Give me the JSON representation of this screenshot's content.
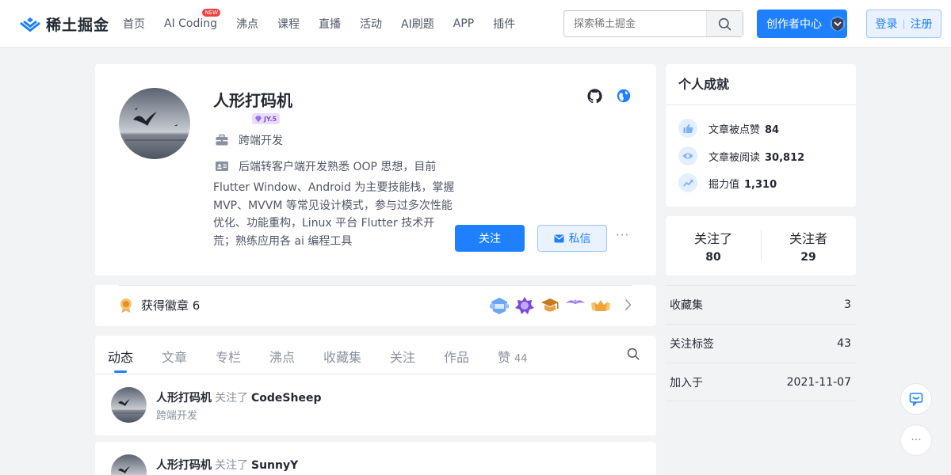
{
  "header": {
    "logo_text": "稀土掘金",
    "nav": [
      {
        "label": "首页"
      },
      {
        "label": "AI Coding",
        "badge": "NEW"
      },
      {
        "label": "沸点"
      },
      {
        "label": "课程"
      },
      {
        "label": "直播"
      },
      {
        "label": "活动"
      },
      {
        "label": "AI刷题"
      },
      {
        "label": "APP"
      },
      {
        "label": "插件"
      }
    ],
    "search_placeholder": "探索稀土掘金",
    "creator_label": "创作者中心",
    "login_label": "登录",
    "login_sep": "|",
    "register_label": "注册"
  },
  "profile": {
    "name": "人形打码机",
    "level": "JY.5",
    "job": "跨端开发",
    "bio_first": "后端转客户端开发熟悉 OOP 思想，目前",
    "bio_rest": "Flutter Window、Android 为主要技能栈，掌握 MVP、MVVM 等常见设计模式，参与过多次性能优化、功能重构，Linux 平台 Flutter 技术开荒；熟练应用各 ai 编程工具",
    "follow_label": "关注",
    "message_label": "私信",
    "more_label": "···"
  },
  "badges": {
    "title": "获得徽章 6"
  },
  "tabs": [
    {
      "label": "动态"
    },
    {
      "label": "文章"
    },
    {
      "label": "专栏"
    },
    {
      "label": "沸点"
    },
    {
      "label": "收藏集"
    },
    {
      "label": "关注"
    },
    {
      "label": "作品"
    },
    {
      "label": "赞",
      "count": "44"
    }
  ],
  "activities": [
    {
      "name": "人形打码机",
      "verb": "关注了",
      "target": "CodeSheep",
      "sub": "跨端开发"
    },
    {
      "name": "人形打码机",
      "verb": "关注了",
      "target": "SunnyY",
      "sub": ""
    }
  ],
  "achievements": {
    "title": "个人成就",
    "rows": [
      {
        "label": "文章被点赞",
        "value": "84"
      },
      {
        "label": "文章被阅读",
        "value": "30,812"
      },
      {
        "label": "掘力值",
        "value": "1,310"
      }
    ]
  },
  "follow_stats": {
    "following_label": "关注了",
    "following": "80",
    "followers_label": "关注者",
    "followers": "29"
  },
  "stats": [
    {
      "label": "收藏集",
      "value": "3"
    },
    {
      "label": "关注标签",
      "value": "43"
    },
    {
      "label": "加入于",
      "value": "2021-11-07"
    }
  ],
  "float": {
    "more_label": "···"
  },
  "colors": {
    "accent": "#1e80ff",
    "badge_new": "#f53f3f",
    "background": "#f2f3f5"
  }
}
